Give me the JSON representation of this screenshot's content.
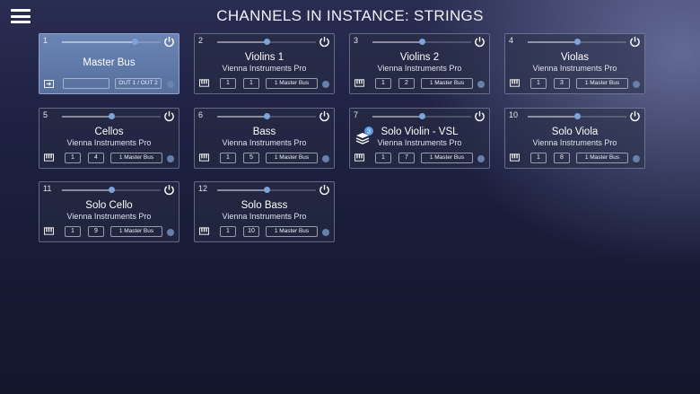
{
  "header": {
    "title": "CHANNELS IN INSTANCE: STRINGS"
  },
  "master": {
    "number": "1",
    "name": "Master Bus",
    "output": "OUT 1 / OUT 2",
    "volume": 0.74
  },
  "channels": [
    {
      "number": "2",
      "name": "Violins 1",
      "sub": "Vienna Instruments Pro",
      "a": "1",
      "b": "1",
      "bus": "1 Master Bus",
      "volume": 0.5
    },
    {
      "number": "3",
      "name": "Violins 2",
      "sub": "Vienna Instruments Pro",
      "a": "1",
      "b": "2",
      "bus": "1 Master Bus",
      "volume": 0.5
    },
    {
      "number": "4",
      "name": "Violas",
      "sub": "Vienna Instruments Pro",
      "a": "1",
      "b": "3",
      "bus": "1 Master Bus",
      "volume": 0.5
    },
    {
      "number": "5",
      "name": "Cellos",
      "sub": "Vienna Instruments Pro",
      "a": "1",
      "b": "4",
      "bus": "1 Master Bus",
      "volume": 0.5
    },
    {
      "number": "6",
      "name": "Bass",
      "sub": "Vienna Instruments Pro",
      "a": "1",
      "b": "5",
      "bus": "1 Master Bus",
      "volume": 0.5
    },
    {
      "number": "7",
      "name": "Solo Violin - VSL",
      "sub": "Vienna Instruments Pro",
      "a": "1",
      "b": "7",
      "bus": "1 Master Bus",
      "volume": 0.5,
      "badge": "3"
    },
    {
      "number": "10",
      "name": "Solo Viola",
      "sub": "Vienna Instruments Pro",
      "a": "1",
      "b": "8",
      "bus": "1 Master Bus",
      "volume": 0.5
    },
    {
      "number": "11",
      "name": "Solo Cello",
      "sub": "Vienna Instruments Pro",
      "a": "1",
      "b": "9",
      "bus": "1 Master Bus",
      "volume": 0.5
    },
    {
      "number": "12",
      "name": "Solo Bass",
      "sub": "Vienna Instruments Pro",
      "a": "1",
      "b": "10",
      "bus": "1 Master Bus",
      "volume": 0.5
    }
  ],
  "colors": {
    "accent": "#7ea3d9",
    "master_bg": "#6a84b4"
  },
  "icons": {
    "menu": "hamburger-icon",
    "power": "power-icon",
    "piano": "piano-keys-icon",
    "route": "routing-icon",
    "layers": "layers-icon"
  }
}
